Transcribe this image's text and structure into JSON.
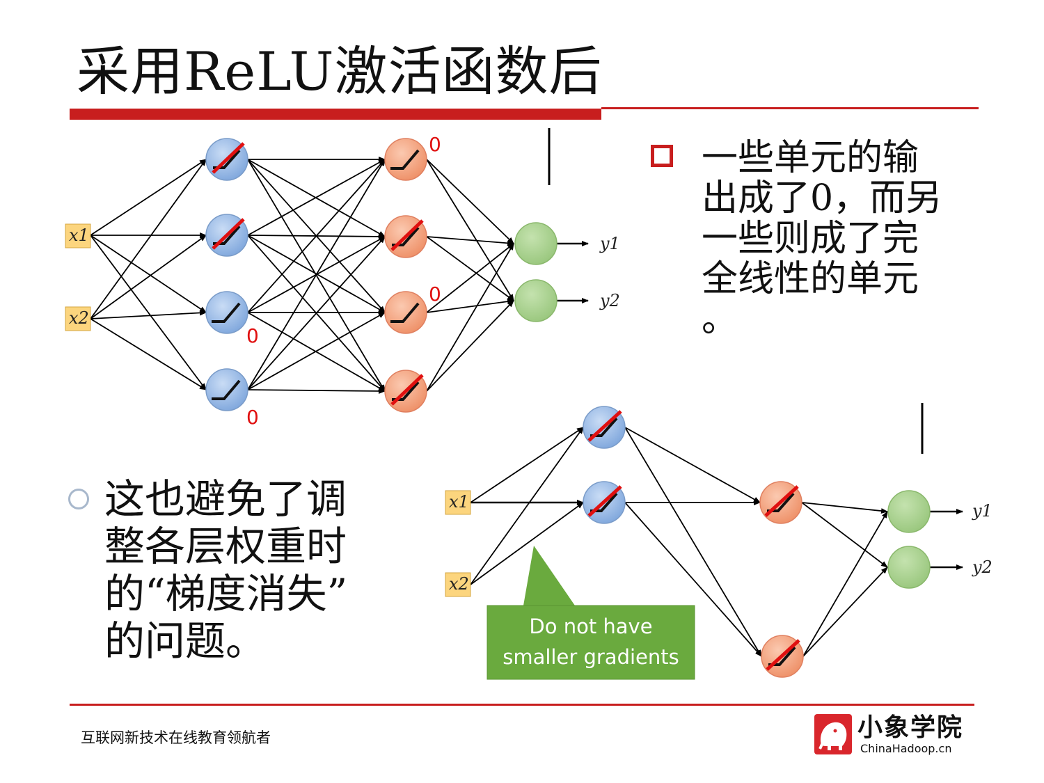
{
  "title": "采用ReLU激活函数后",
  "bullet_top": {
    "lines": [
      "一些单元的输",
      "出成了0，而另",
      "一些则成了完",
      "全线性的单元",
      "。"
    ]
  },
  "bullet_bottom": {
    "lines": [
      "这也避免了调",
      "整各层权重时",
      "的“梯度消失”",
      "的问题。"
    ]
  },
  "network1": {
    "inputs": [
      "x1",
      "x2"
    ],
    "outputs": [
      "y1",
      "y2"
    ],
    "zero_label": "0"
  },
  "network2": {
    "inputs": [
      "x1",
      "x2"
    ],
    "outputs": [
      "y1",
      "y2"
    ],
    "callout": [
      "Do not have",
      "smaller gradients"
    ]
  },
  "footer": "互联网新技术在线教育领航者",
  "logo": {
    "name": "小象学院",
    "domain": "ChinaHadoop.cn"
  },
  "colors": {
    "accent_red": "#c81e1e",
    "blue_neuron": "#8fb4e3",
    "orange_neuron": "#f0a080",
    "green_neuron": "#a9d18e",
    "input_box": "#fcd57e",
    "callout_green": "#6aaa3e"
  }
}
